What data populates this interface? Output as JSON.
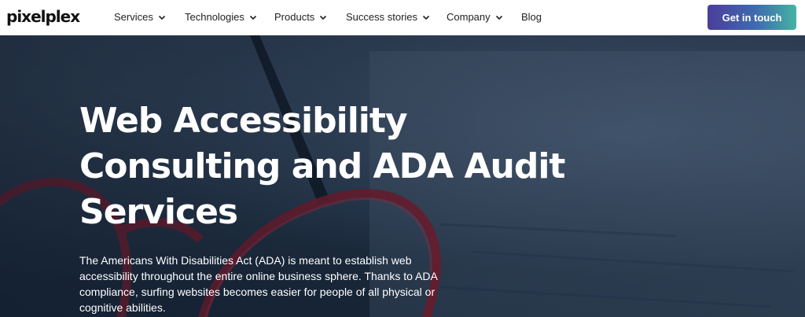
{
  "brand": {
    "logo_text": "pixelplex"
  },
  "nav": {
    "items": [
      {
        "label": "Services",
        "has_dropdown": true
      },
      {
        "label": "Technologies",
        "has_dropdown": true
      },
      {
        "label": "Products",
        "has_dropdown": true
      },
      {
        "label": "Success stories",
        "has_dropdown": true
      },
      {
        "label": "Company",
        "has_dropdown": true
      },
      {
        "label": "Blog",
        "has_dropdown": false
      }
    ],
    "cta_label": "Get in touch"
  },
  "hero": {
    "title_line1": "Web Accessibility",
    "title_line2": "Consulting and ADA Audit",
    "title_line3": "Services",
    "description": "The Americans With Disabilities Act (ADA) is meant to establish web accessibility throughout the entire online business sphere. Thanks to ADA compliance, surfing websites becomes easier for people of all physical or cognitive abilities."
  },
  "colors": {
    "cta_gradient": [
      "#4b3d9c",
      "#3f6cae",
      "#45b3a3"
    ],
    "hero_bg": "#233348",
    "glasses_frame": "#8a1d2e"
  }
}
